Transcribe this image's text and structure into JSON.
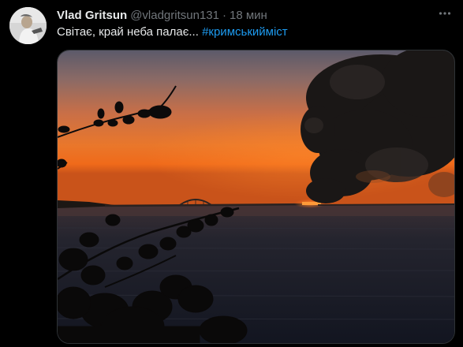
{
  "tweet": {
    "author_name": "Vlad Gritsun",
    "author_handle": "@vladgritsun131",
    "separator": "·",
    "time": "18 мин",
    "text": "Світає, край неба палає...",
    "hashtag": "#кримськийміст"
  },
  "icons": {
    "avatar": "profile-photo",
    "more": "more-options-icon"
  },
  "colors": {
    "background": "#000000",
    "text": "#e7e9ea",
    "secondary": "#71767b",
    "link": "#1d9bf0"
  }
}
